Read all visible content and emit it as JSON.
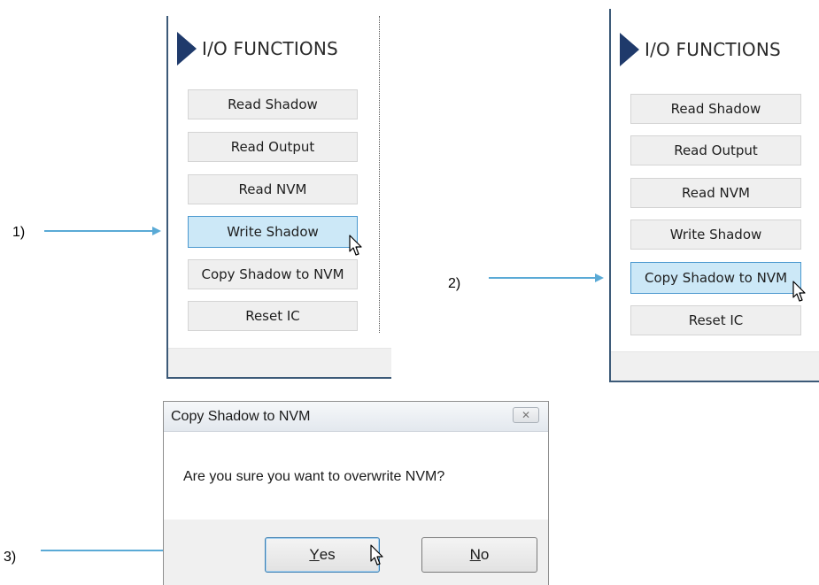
{
  "steps": {
    "one": "1)",
    "two": "2)",
    "three": "3)"
  },
  "panel_title": "I/O FUNCTIONS",
  "io_buttons": [
    "Read Shadow",
    "Read Output",
    "Read NVM",
    "Write Shadow",
    "Copy Shadow to NVM",
    "Reset IC"
  ],
  "panel1_hovered": "Write Shadow",
  "panel2_hovered": "Copy Shadow to NVM",
  "dialog": {
    "title": "Copy Shadow to NVM",
    "close_glyph": "✕",
    "message": "Are you sure you want to overwrite NVM?",
    "yes_mnemonic": "Y",
    "yes_rest": "es",
    "no_mnemonic": "N",
    "no_rest": "o"
  },
  "colors": {
    "arrow": "#5aaad6",
    "hover_bg": "#cce8f7",
    "hover_border": "#4a98cf",
    "title_marker": "#1f3a6b"
  },
  "icons": {
    "pointer": "mouse-pointer-icon",
    "arrow": "callout-arrow-icon",
    "marker": "triangle-marker-icon",
    "close": "close-icon"
  }
}
